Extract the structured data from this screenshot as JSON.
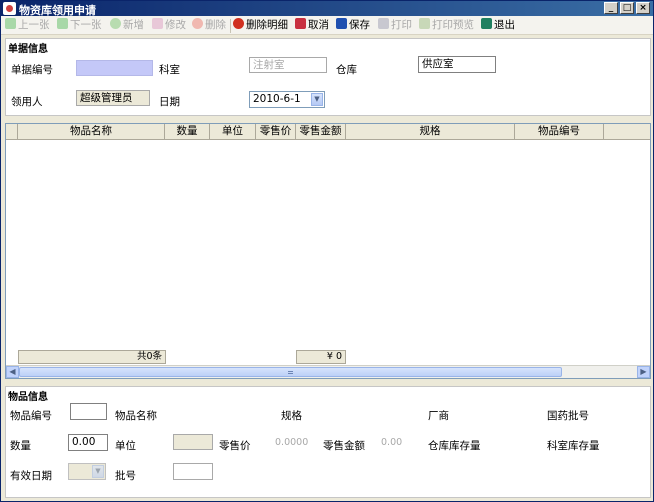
{
  "window": {
    "title": "物资库领用申请"
  },
  "toolbar": {
    "prev": "上一张",
    "next": "下一张",
    "add": "新增",
    "edit": "修改",
    "delete": "删除",
    "delete_detail": "删除明细",
    "cancel": "取消",
    "save": "保存",
    "print": "打印",
    "print_preview": "打印预览",
    "exit": "退出"
  },
  "doc": {
    "section_title": "单据信息",
    "doc_no_label": "单据编号",
    "doc_no_value": "",
    "dept_label": "科室",
    "dept_value": "注射室",
    "warehouse_label": "仓库",
    "warehouse_value": "供应室",
    "receiver_label": "领用人",
    "receiver_value": "超级管理员",
    "date_label": "日期",
    "date_value": "2010-6-1"
  },
  "grid": {
    "columns": [
      "",
      "物品名称",
      "数量",
      "单位",
      "零售价",
      "零售金额",
      "规格",
      "物品编号"
    ],
    "footer_count": "共0条",
    "footer_amount": "¥ 0"
  },
  "item": {
    "section_title": "物品信息",
    "code_label": "物品编号",
    "code_value": "",
    "name_label": "物品名称",
    "spec_label": "规格",
    "maker_label": "厂商",
    "approval_label": "国药批号",
    "qty_label": "数量",
    "qty_value": "0.00",
    "unit_label": "单位",
    "unit_value": "",
    "price_label": "零售价",
    "price_value": "0.0000",
    "amount_label": "零售金额",
    "amount_value": "0.00",
    "wh_stock_label": "仓库库存量",
    "dept_stock_label": "科室库存量",
    "expiry_label": "有效日期",
    "expiry_value": "",
    "batch_label": "批号",
    "batch_value": ""
  }
}
